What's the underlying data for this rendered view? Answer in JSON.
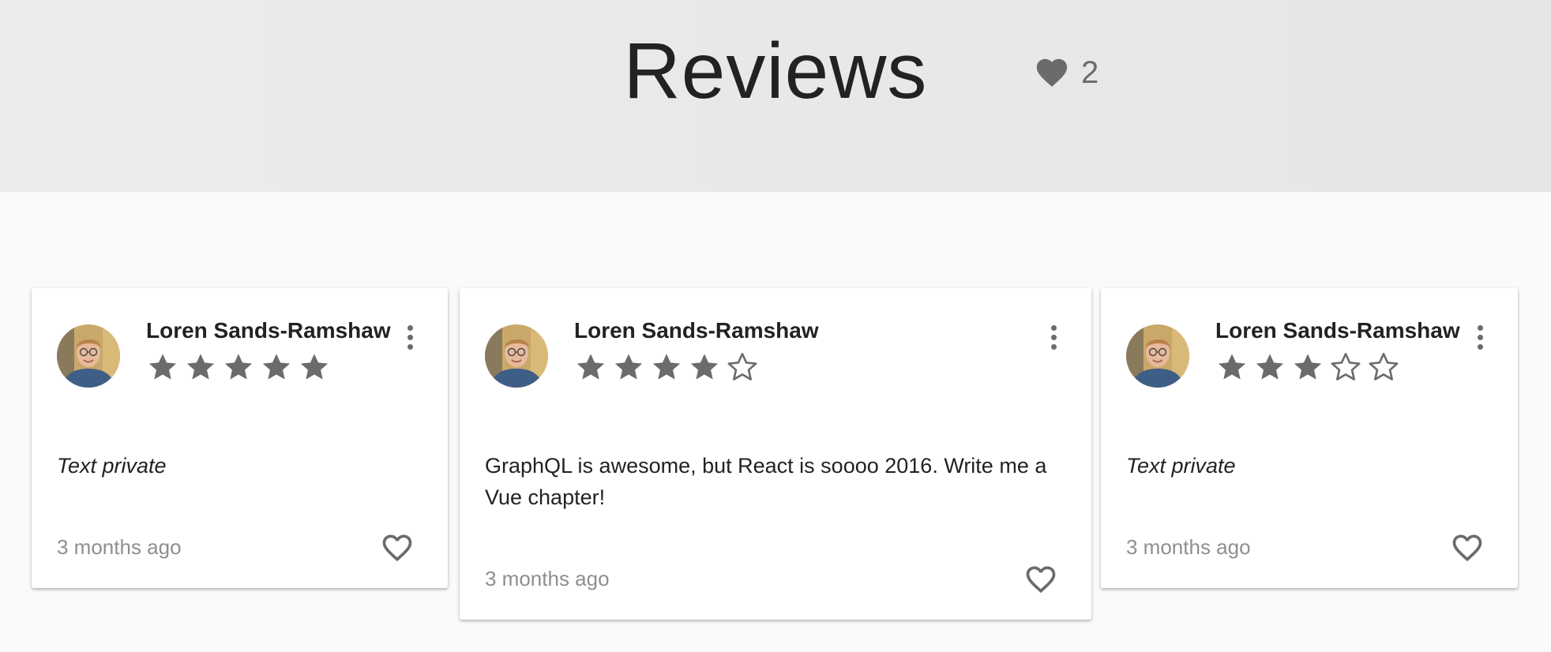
{
  "header": {
    "title": "Reviews",
    "favorites_icon": "heart-icon",
    "favorites_count": "2"
  },
  "colors": {
    "header_bg": "#e8e8e8",
    "page_bg": "#fafafa",
    "icon_gray": "#6b6b6b",
    "timestamp_gray": "#8f8f8f"
  },
  "reviews": [
    {
      "author": "Loren Sands-Ramshaw",
      "rating": 5,
      "max_rating": 5,
      "text": "Text private",
      "text_private": true,
      "time": "3 months ago",
      "menu_icon": "more-vert-icon",
      "like_icon": "heart-outline-icon"
    },
    {
      "author": "Loren Sands-Ramshaw",
      "rating": 4,
      "max_rating": 5,
      "text": "GraphQL is awesome, but React is soooo 2016. Write me a Vue chapter!",
      "text_private": false,
      "time": "3 months ago",
      "menu_icon": "more-vert-icon",
      "like_icon": "heart-outline-icon"
    },
    {
      "author": "Loren Sands-Ramshaw",
      "rating": 3,
      "max_rating": 5,
      "text": "Text private",
      "text_private": true,
      "time": "3 months ago",
      "menu_icon": "more-vert-icon",
      "like_icon": "heart-outline-icon"
    }
  ]
}
